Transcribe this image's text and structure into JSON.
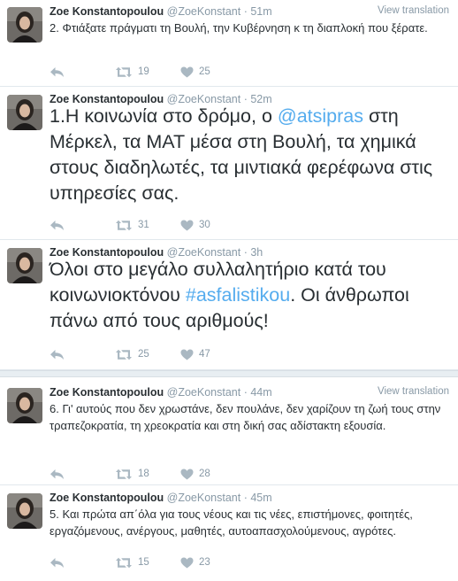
{
  "tweets": [
    {
      "fullname": "Zoe Konstantopoulou",
      "handle": "@ZoeKonstant",
      "time": "· 51m",
      "view_translation": "View translation",
      "text_parts": [
        "2. Φτιάξατε πράγματι τη Βουλή, την Κυβέρνηση κ τη διαπλοκή που ξέρατε."
      ],
      "retweets": "19",
      "likes": "25"
    },
    {
      "fullname": "Zoe Konstantopoulou",
      "handle": "@ZoeKonstant",
      "time": "· 52m",
      "text_parts": [
        "1.Η κοινωνία στο δρόμο, ο ",
        "@atsipras",
        " στη Μέρκελ, τα ΜΑΤ μέσα στη Βουλή, τα χημικά στους διαδηλωτές, τα μιντιακά φερέφωνα στις υπηρεσίες σας."
      ],
      "retweets": "31",
      "likes": "30"
    },
    {
      "fullname": "Zoe Konstantopoulou",
      "handle": "@ZoeKonstant",
      "time": "· 3h",
      "text_parts": [
        "Όλοι στο μεγάλο συλλαλητήριο κατά του κοινωνιοκτόνου ",
        "#asfalistikou",
        ". Οι άνθρωποι πάνω από τους αριθμούς!"
      ],
      "retweets": "25",
      "likes": "47"
    },
    {
      "fullname": "Zoe Konstantopoulou",
      "handle": "@ZoeKonstant",
      "time": "· 44m",
      "view_translation": "View translation",
      "text_parts": [
        "6. Γι' αυτούς που δεν χρωστάνε, δεν πουλάνε, δεν χαρίζουν τη ζωή τους στην τραπεζοκρατία, τη χρεοκρατία και στη δική σας αδίστακτη εξουσία."
      ],
      "retweets": "18",
      "likes": "28"
    },
    {
      "fullname": "Zoe Konstantopoulou",
      "handle": "@ZoeKonstant",
      "time": "· 45m",
      "text_parts": [
        "5. Και πρώτα απ΄όλα για τους νέους και τις νέες, επιστήμονες, φοιτητές, εργαζόμενους, ανέργους, μαθητές, αυτοαπασχολούμενους, αγρότες."
      ],
      "retweets": "15",
      "likes": "23"
    }
  ],
  "colors": {
    "link": "#55acee",
    "muted": "#8899a6",
    "text": "#292f33",
    "separator": "#e8eef2"
  }
}
